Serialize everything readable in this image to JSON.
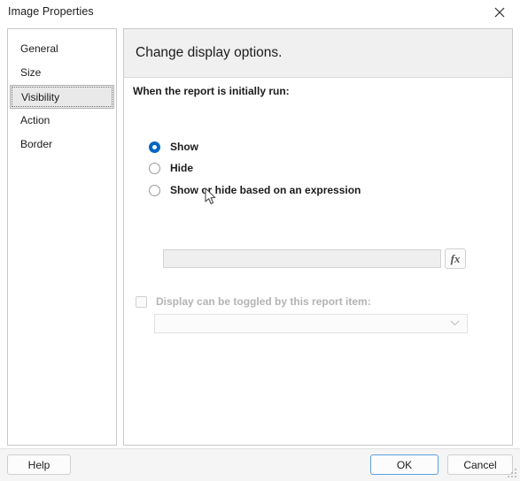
{
  "window": {
    "title": "Image Properties",
    "close_icon": "close-icon"
  },
  "sidebar": {
    "items": [
      {
        "label": "General"
      },
      {
        "label": "Size"
      },
      {
        "label": "Visibility"
      },
      {
        "label": "Action"
      },
      {
        "label": "Border"
      }
    ],
    "selected": "Visibility"
  },
  "main": {
    "header": "Change display options.",
    "section_label": "When the report is initially run:",
    "radios": [
      {
        "label": "Show",
        "checked": true
      },
      {
        "label": "Hide",
        "checked": false
      },
      {
        "label": "Show or hide based on an expression",
        "checked": false
      }
    ],
    "expression": {
      "value": "",
      "placeholder": "",
      "fx_label": "fx",
      "enabled": false
    },
    "toggle": {
      "checkbox_label": "Display can be toggled by this report item:",
      "checked": false,
      "enabled": false,
      "dropdown_value": "",
      "dropdown_icon": "chevron-down-icon"
    }
  },
  "footer": {
    "help_label": "Help",
    "ok_label": "OK",
    "cancel_label": "Cancel"
  },
  "colors": {
    "accent": "#0067c0",
    "default_button_border": "#5ba0dd",
    "header_band": "#f0f0f0",
    "selected_nav": "#e9e9e9",
    "disabled_text": "#b3b3b3"
  }
}
